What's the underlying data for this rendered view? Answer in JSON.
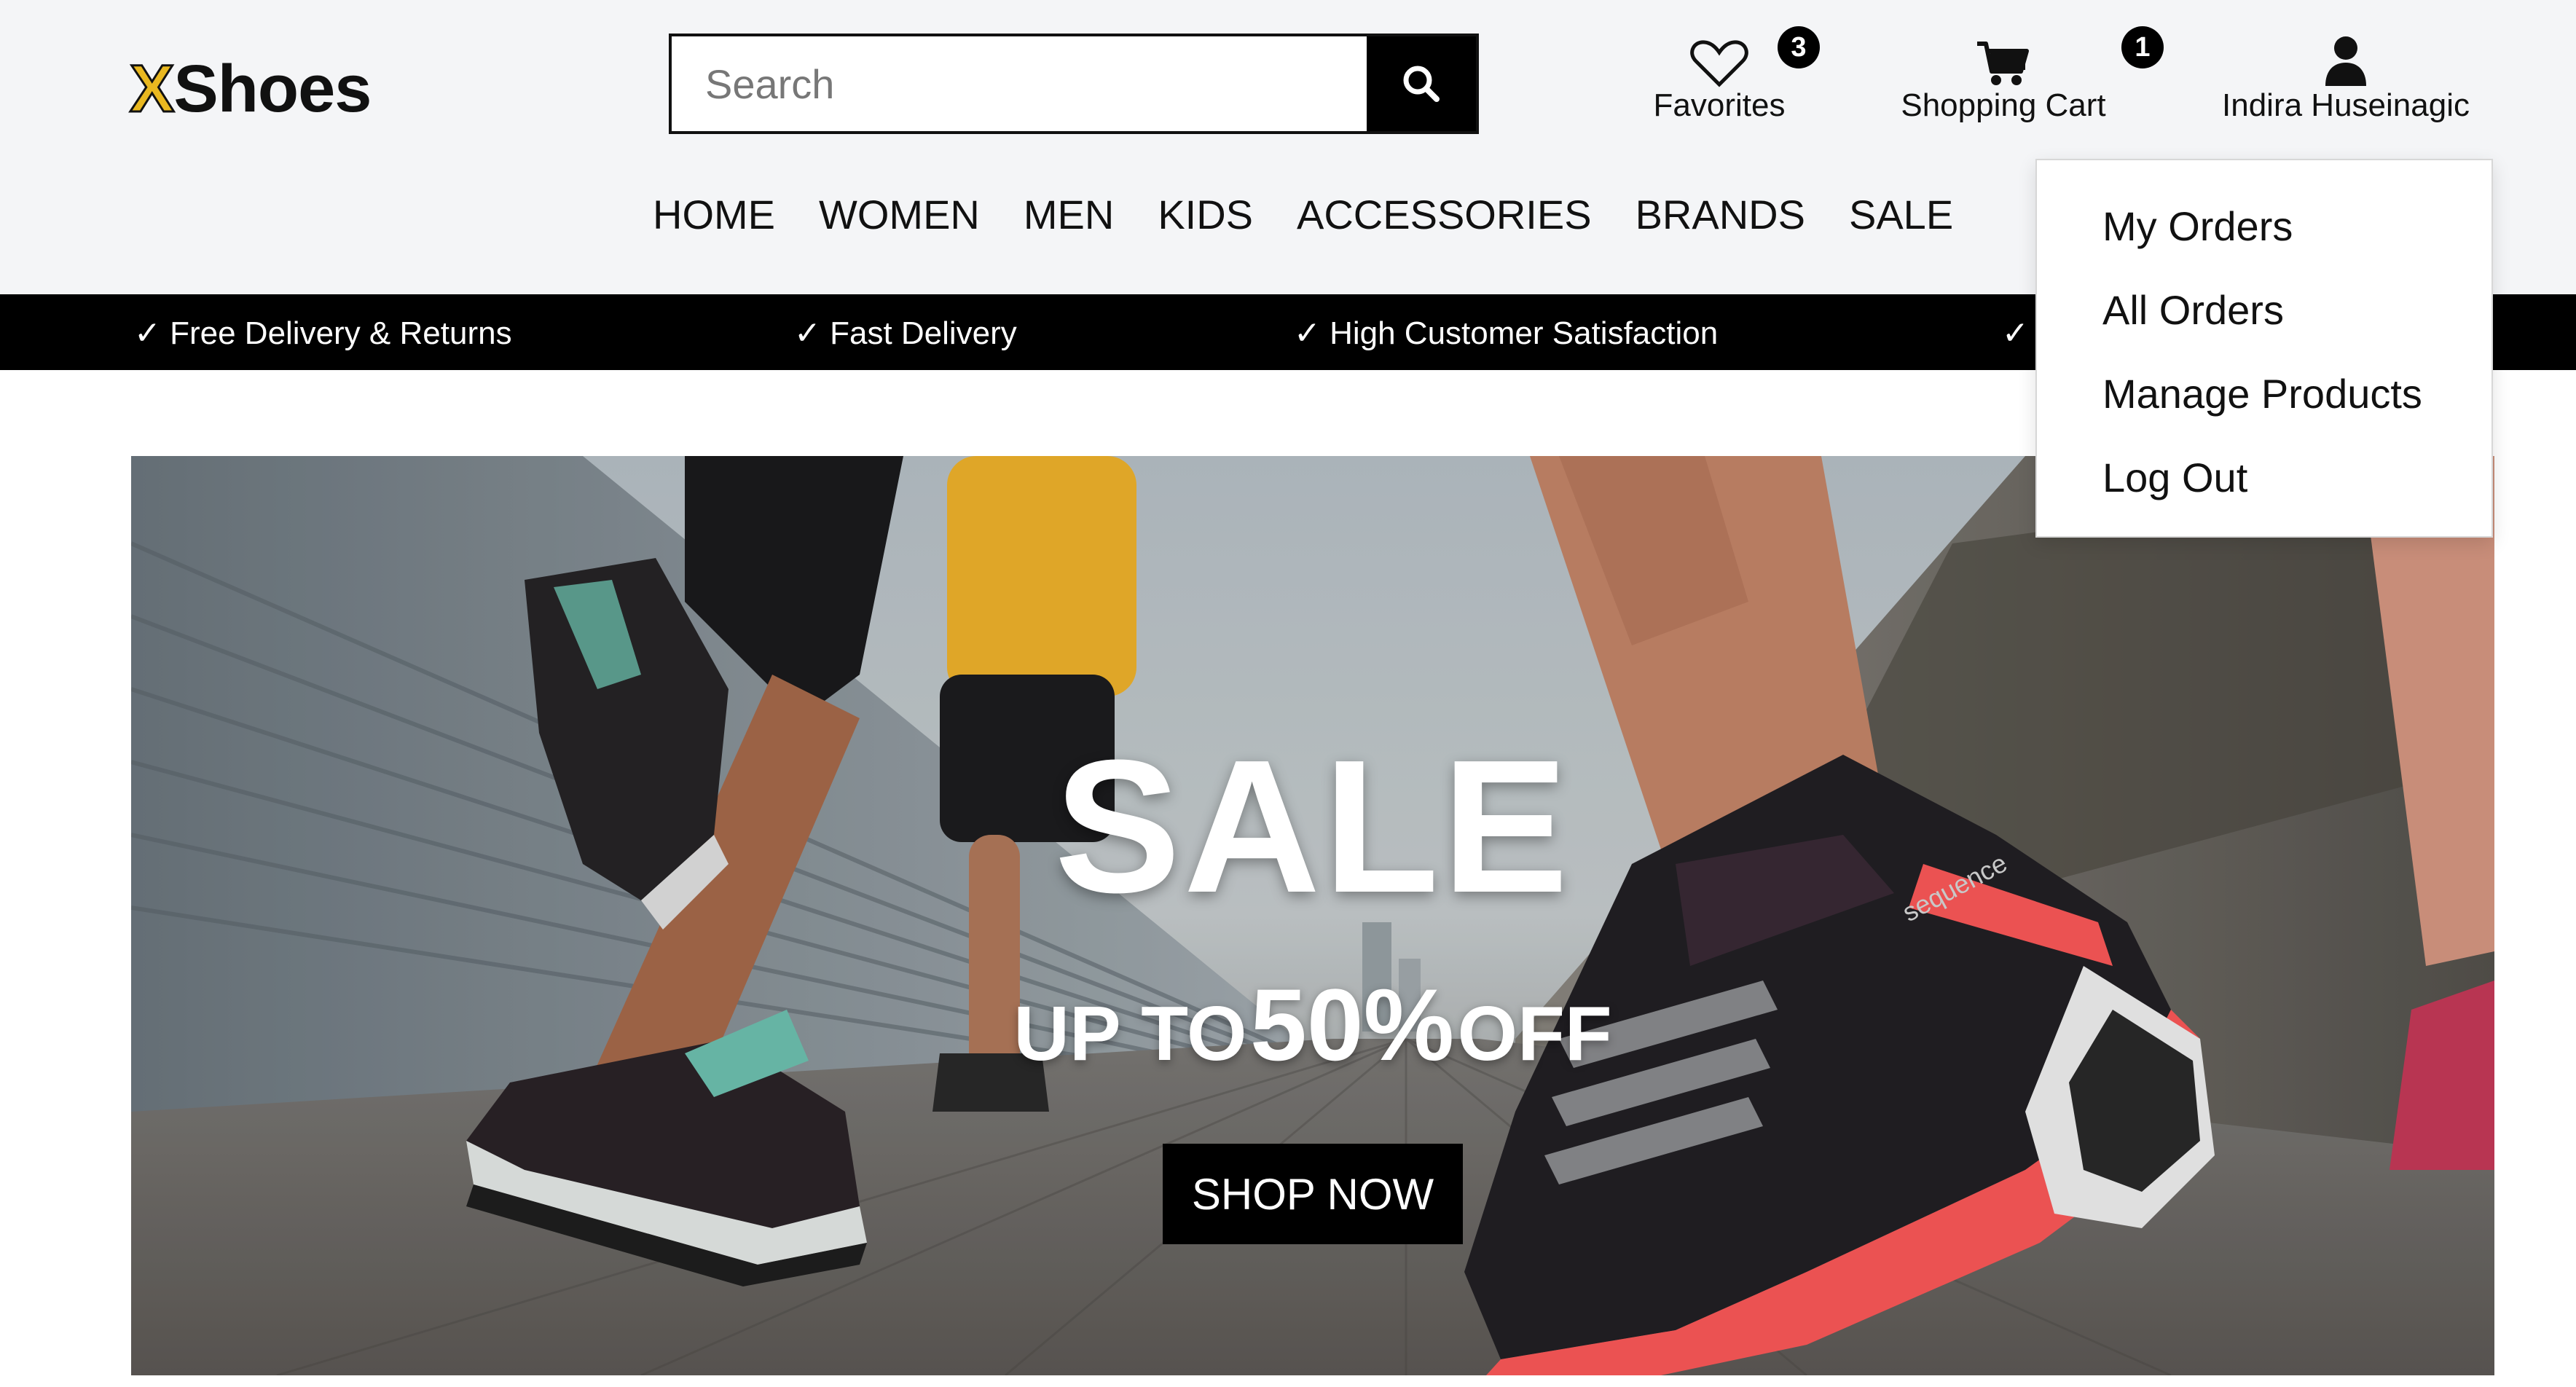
{
  "brand": {
    "logo_x": "X",
    "logo_rest": "Shoes"
  },
  "search": {
    "placeholder": "Search"
  },
  "header": {
    "favorites": {
      "label": "Favorites",
      "count": "3"
    },
    "cart": {
      "label": "Shopping Cart",
      "count": "1"
    },
    "user": {
      "name": "Indira Huseinagic"
    }
  },
  "nav": {
    "items": [
      "HOME",
      "WOMEN",
      "MEN",
      "KIDS",
      "ACCESSORIES",
      "BRANDS",
      "SALE"
    ]
  },
  "strip": {
    "items": [
      "✓ Free Delivery & Returns",
      "✓ Fast Delivery",
      "✓ High Customer Satisfaction",
      "✓"
    ]
  },
  "user_menu": {
    "items": [
      "My Orders",
      "All Orders",
      "Manage Products",
      "Log Out"
    ]
  },
  "hero": {
    "title": "SALE",
    "subtitle_prefix": "UP TO",
    "subtitle_value": "50%",
    "subtitle_suffix": "OFF",
    "button": "SHOP NOW",
    "shoe_text": "sequence"
  },
  "colors": {
    "accent": "#e9b820",
    "header_bg": "#f4f5f7",
    "strip_bg": "#000000",
    "shoe_accent": "#ff5a5a"
  }
}
